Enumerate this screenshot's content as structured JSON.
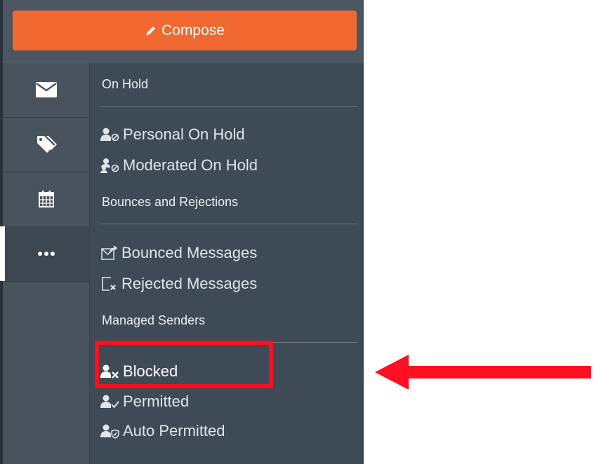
{
  "compose": {
    "label": "Compose",
    "icon": "pencil-icon",
    "color": "#ef6930"
  },
  "rail": {
    "items": [
      {
        "icon": "envelope-icon",
        "active": false
      },
      {
        "icon": "tags-icon",
        "active": false
      },
      {
        "icon": "calendar-icon",
        "active": false
      },
      {
        "icon": "more-icon",
        "active": true
      }
    ]
  },
  "menu": {
    "sections": [
      {
        "heading": "On Hold",
        "items": [
          {
            "label": "Personal On Hold",
            "icon": "user-hold-icon"
          },
          {
            "label": "Moderated On Hold",
            "icon": "users-hold-icon"
          }
        ]
      },
      {
        "heading": "Bounces and Rejections",
        "items": [
          {
            "label": "Bounced Messages",
            "icon": "bounced-message-icon"
          },
          {
            "label": "Rejected Messages",
            "icon": "rejected-message-icon"
          }
        ]
      },
      {
        "heading": "Managed Senders",
        "items": [
          {
            "label": "Blocked",
            "icon": "user-blocked-icon",
            "highlighted": true
          },
          {
            "label": "Permitted",
            "icon": "user-permitted-icon"
          },
          {
            "label": "Auto Permitted",
            "icon": "user-auto-permitted-icon"
          }
        ]
      }
    ]
  },
  "annotation": {
    "highlight_color": "#ff1020",
    "arrow_color": "#ff1020"
  }
}
